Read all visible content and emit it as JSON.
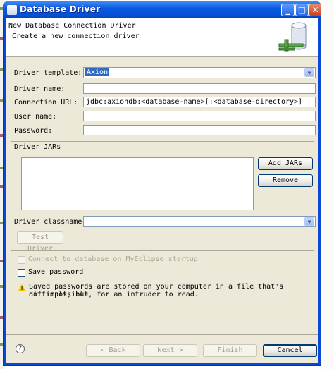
{
  "window": {
    "title": "Database Driver",
    "minimize_glyph": "_",
    "maximize_glyph": "□",
    "close_glyph": "✕"
  },
  "banner": {
    "title": "New Database Connection Driver",
    "message": "Create a new connection driver",
    "icon": "database-icon"
  },
  "form": {
    "driver_template_label": "Driver template:",
    "driver_template_value": "Axion",
    "driver_name_label": "Driver name:",
    "driver_name_value": "",
    "connection_url_label": "Connection URL:",
    "connection_url_value": "jdbc:axiondb:<database-name>[:<database-directory>]",
    "user_name_label": "User name:",
    "user_name_value": "",
    "password_label": "Password:",
    "password_value": ""
  },
  "jars": {
    "label": "Driver JARs",
    "add_button": "Add JARs",
    "remove_button": "Remove"
  },
  "classname": {
    "label": "Driver classname:",
    "value": "",
    "test_button": "Test Driver"
  },
  "options": {
    "connect_on_startup_label": "Connect to database on MyEclipse startup",
    "connect_on_startup_checked": false,
    "save_password_label": "Save password",
    "save_password_checked": false
  },
  "warning": {
    "line1": "Saved passwords are stored on your computer in a file that's difficult, but",
    "line2": "not impossible, for an intruder to read."
  },
  "footer": {
    "back_button": "< Back",
    "next_button": "Next >",
    "finish_button": "Finish",
    "cancel_button": "Cancel"
  },
  "colors": {
    "title_bar": "#0a5ae0",
    "dialog_bg": "#ece9d8",
    "selection": "#316ac5",
    "field_border": "#7f9db9"
  }
}
